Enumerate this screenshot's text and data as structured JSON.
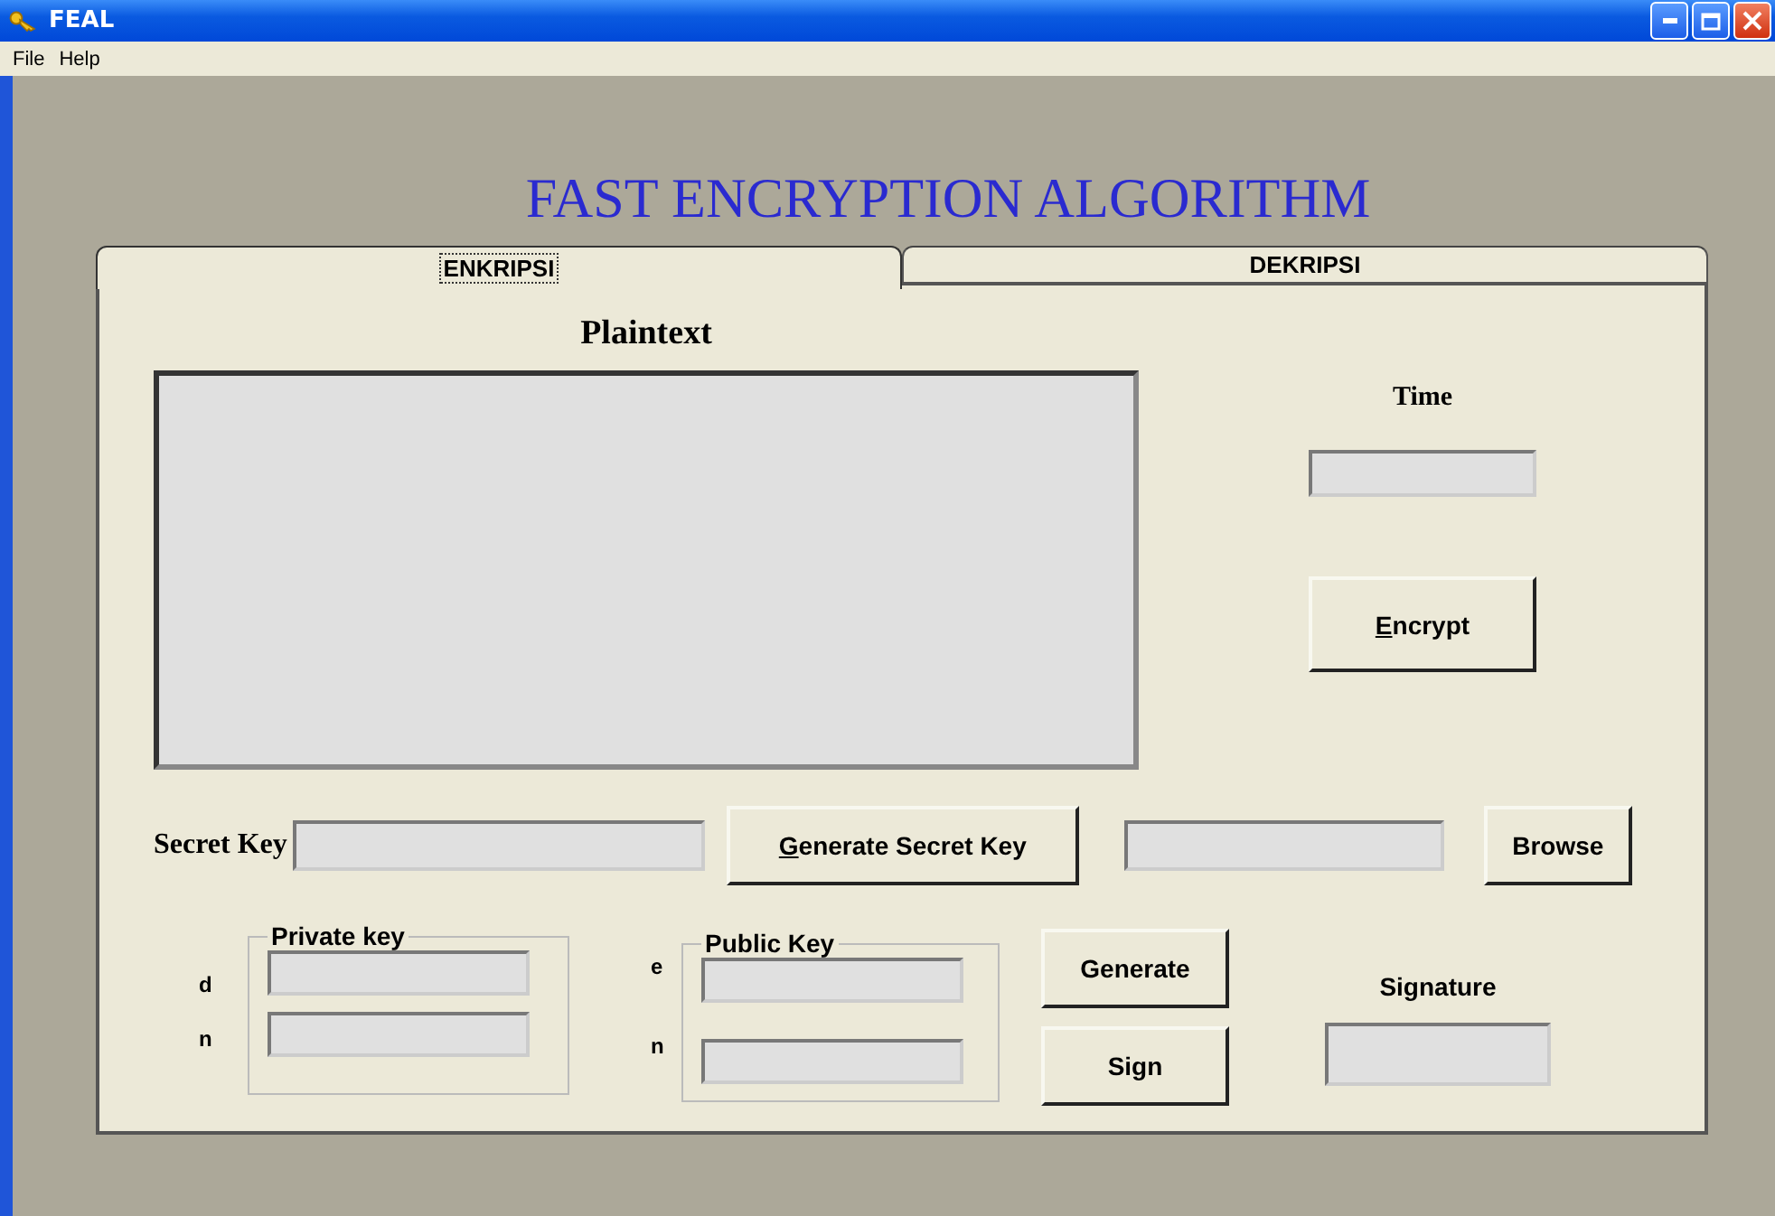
{
  "window": {
    "title": "FEAL"
  },
  "menu": [
    "File",
    "Help"
  ],
  "heading": "FAST ENCRYPTION ALGORITHM",
  "tabs": [
    {
      "label": "ENKRIPSI",
      "selected": true
    },
    {
      "label": "DEKRIPSI",
      "selected": false
    }
  ],
  "plaintext_label": "Plaintext",
  "time_label": "Time",
  "encrypt_button": {
    "label": "Encrypt",
    "mnemonic": true
  },
  "secret_key_label": "Secret Key",
  "generate_secret_key_button": {
    "label": "Generate Secret Key",
    "mnemonic": true
  },
  "browse_button": {
    "label": "Browse",
    "mnemonic": false
  },
  "private_key": {
    "title": "Private key",
    "fields": [
      "d",
      "n"
    ]
  },
  "public_key": {
    "title": "Public Key",
    "fields": [
      "e",
      "n"
    ]
  },
  "generate_button": {
    "label": "Generate",
    "mnemonic": false
  },
  "sign_button": {
    "label": "Sign",
    "mnemonic": false
  },
  "signature_label": "Signature"
}
